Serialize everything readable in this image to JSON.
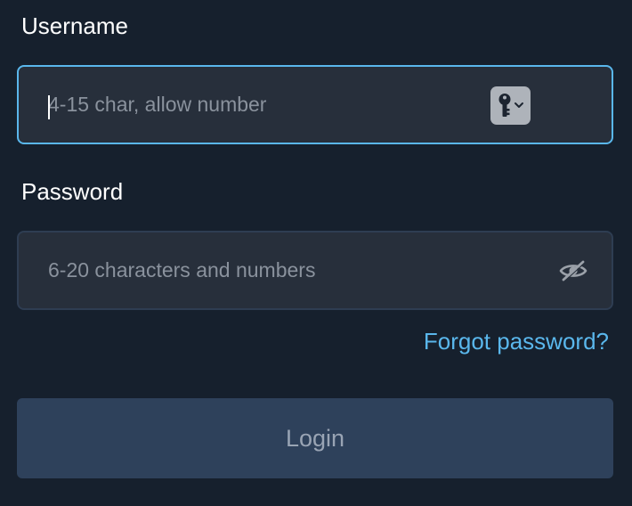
{
  "username": {
    "label": "Username",
    "value": "",
    "placeholder": "4-15 char, allow number",
    "icon": "key-autofill-icon"
  },
  "password": {
    "label": "Password",
    "value": "",
    "placeholder": "6-20 characters and numbers",
    "icon": "eye-off-icon"
  },
  "forgot_password": "Forgot password?",
  "login_label": "Login",
  "colors": {
    "background": "#16202d",
    "field_background": "#272f3b",
    "focus_border": "#5ab7ec",
    "link": "#5ab7ec",
    "button_background": "#2e415b",
    "button_text": "#99a4b4"
  }
}
